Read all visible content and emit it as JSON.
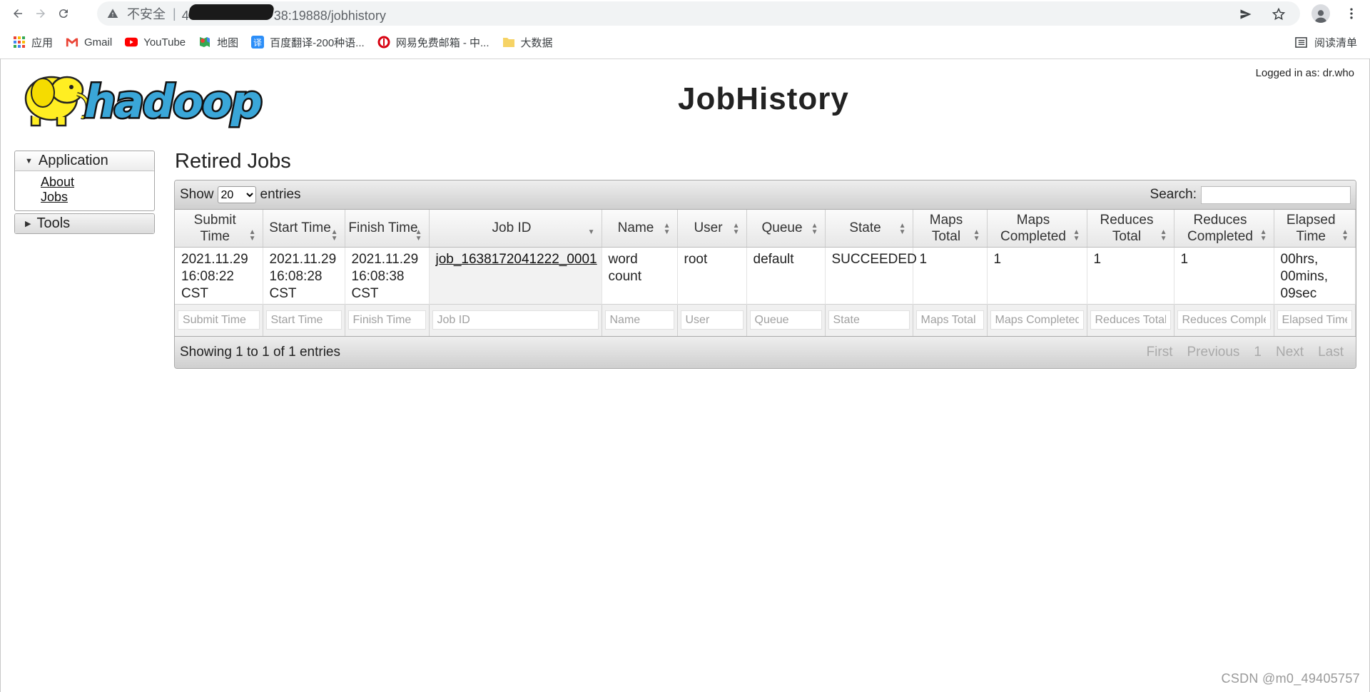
{
  "browser": {
    "insecure_label": "不安全",
    "separator": "|",
    "url_prefix": "4",
    "url_suffix": "38:19888/jobhistory"
  },
  "bookmarks": {
    "items": [
      {
        "label": "应用",
        "icon": "apps-grid-icon"
      },
      {
        "label": "Gmail",
        "icon": "gmail-icon"
      },
      {
        "label": "YouTube",
        "icon": "youtube-icon"
      },
      {
        "label": "地图",
        "icon": "maps-icon"
      },
      {
        "label": "百度翻译-200种语...",
        "icon": "baidu-translate-icon"
      },
      {
        "label": "网易免费邮箱 - 中...",
        "icon": "netease-mail-icon"
      },
      {
        "label": "大数据",
        "icon": "folder-icon"
      }
    ],
    "reading_list": "阅读清单"
  },
  "header": {
    "logged_in": "Logged in as: dr.who",
    "title": "JobHistory",
    "logo_text": "hadoop"
  },
  "sidebar": {
    "application": "Application",
    "about": "About",
    "jobs": "Jobs",
    "tools": "Tools"
  },
  "main": {
    "section_title": "Retired Jobs",
    "show_label": "Show",
    "entries_label": "entries",
    "page_size": "20",
    "search_label": "Search:",
    "columns": [
      {
        "label": "Submit Time",
        "l1": "Submit",
        "l2": "Time"
      },
      {
        "label": "Start Time",
        "l1": "Start Time",
        "l2": ""
      },
      {
        "label": "Finish Time",
        "l1": "Finish Time",
        "l2": ""
      },
      {
        "label": "Job ID",
        "l1": "Job ID",
        "l2": ""
      },
      {
        "label": "Name",
        "l1": "Name",
        "l2": ""
      },
      {
        "label": "User",
        "l1": "User",
        "l2": ""
      },
      {
        "label": "Queue",
        "l1": "Queue",
        "l2": ""
      },
      {
        "label": "State",
        "l1": "State",
        "l2": ""
      },
      {
        "label": "Maps Total",
        "l1": "Maps",
        "l2": "Total"
      },
      {
        "label": "Maps Completed",
        "l1": "Maps",
        "l2": "Completed"
      },
      {
        "label": "Reduces Total",
        "l1": "Reduces",
        "l2": "Total"
      },
      {
        "label": "Reduces Completed",
        "l1": "Reduces",
        "l2": "Completed"
      },
      {
        "label": "Elapsed Time",
        "l1": "Elapsed",
        "l2": "Time"
      }
    ],
    "rows": [
      {
        "submit_time": [
          "2021.11.29",
          "16:08:22",
          "CST"
        ],
        "start_time": [
          "2021.11.29",
          "16:08:28",
          "CST"
        ],
        "finish_time": [
          "2021.11.29",
          "16:08:38",
          "CST"
        ],
        "job_id": "job_1638172041222_0001",
        "name": [
          "word",
          "count"
        ],
        "user": "root",
        "queue": "default",
        "state": "SUCCEEDED",
        "maps_total": "1",
        "maps_completed": "1",
        "reduces_total": "1",
        "reduces_completed": "1",
        "elapsed": [
          "00hrs,",
          "00mins,",
          "09sec"
        ]
      }
    ],
    "filter_placeholders": [
      "Submit Time",
      "Start Time",
      "Finish Time",
      "Job ID",
      "Name",
      "User",
      "Queue",
      "State",
      "Maps Total",
      "Maps Completed",
      "Reduces Total",
      "Reduces Completed",
      "Elapsed Time"
    ],
    "showing": "Showing 1 to 1 of 1 entries",
    "pager": {
      "first": "First",
      "previous": "Previous",
      "page": "1",
      "next": "Next",
      "last": "Last"
    }
  },
  "watermark": "CSDN @m0_49405757"
}
